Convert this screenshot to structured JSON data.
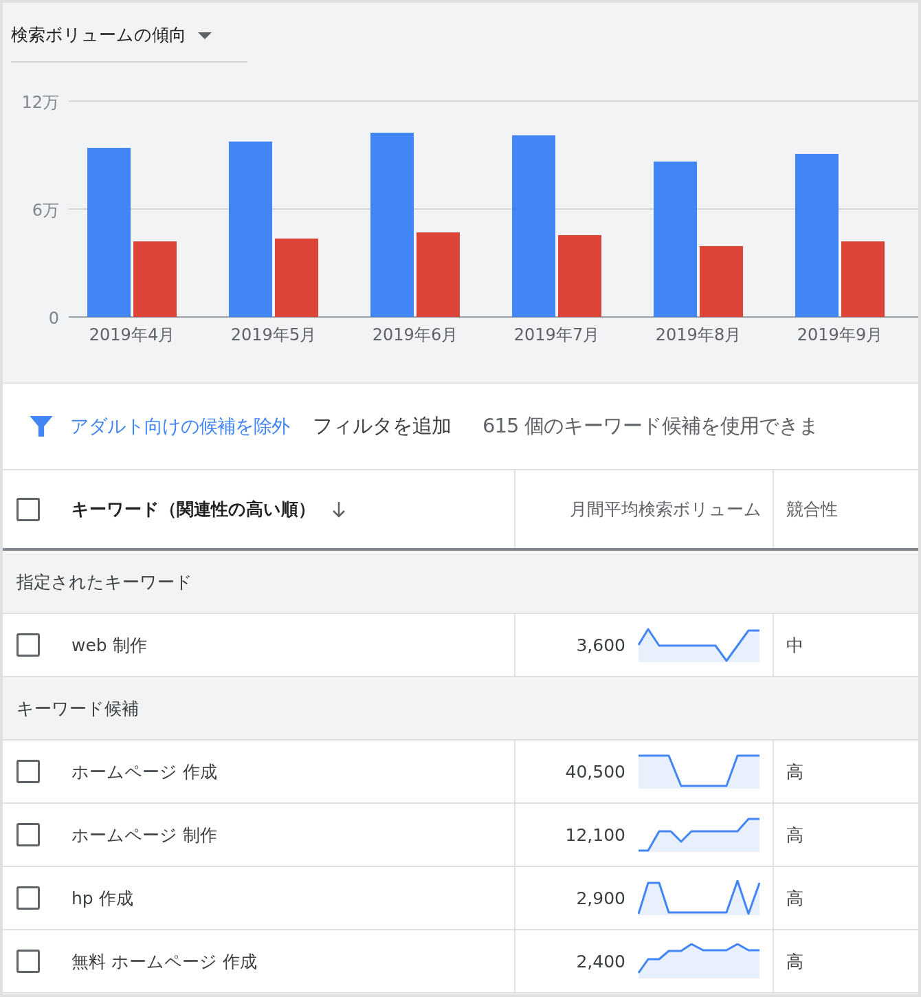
{
  "trend_panel": {
    "title": "検索ボリュームの傾向",
    "chart_data": {
      "type": "bar",
      "categories": [
        "2019年4月",
        "2019年5月",
        "2019年6月",
        "2019年7月",
        "2019年8月",
        "2019年9月"
      ],
      "series": [
        {
          "color": "#4285f4",
          "values": [
            9.4,
            9.75,
            10.24,
            10.1,
            8.64,
            9.06
          ]
        },
        {
          "color": "#db4437",
          "values": [
            4.2,
            4.36,
            4.7,
            4.55,
            3.94,
            4.2
          ]
        }
      ],
      "ylim": [
        0,
        12
      ],
      "yticks": [
        {
          "value": 0,
          "label": "0"
        },
        {
          "value": 6,
          "label": "6万"
        },
        {
          "value": 12,
          "label": "12万"
        }
      ]
    }
  },
  "filter_bar": {
    "exclude_link": "アダルト向けの候補を除外",
    "add_filter": "フィルタを追加",
    "count_text": "615 個のキーワード候補を使用できま"
  },
  "table": {
    "header_checked": false,
    "columns": [
      "キーワード（関連性の高い順）",
      "月間平均検索ボリューム",
      "競合性"
    ],
    "rows": [
      {
        "kind": "section",
        "label": "指定されたキーワード"
      },
      {
        "kind": "keyword",
        "checked": false,
        "keyword": "web 制作",
        "volume": "3,600",
        "competition": "中"
      },
      {
        "kind": "section",
        "label": "キーワード候補"
      },
      {
        "kind": "keyword",
        "checked": false,
        "keyword": "ホームページ 作成",
        "volume": "40,500",
        "competition": "高"
      },
      {
        "kind": "keyword",
        "checked": false,
        "keyword": "ホームページ 制作",
        "volume": "12,100",
        "competition": "高"
      },
      {
        "kind": "keyword",
        "checked": false,
        "keyword": "hp 作成",
        "volume": "2,900",
        "competition": "高"
      },
      {
        "kind": "keyword",
        "checked": false,
        "keyword": "無料 ホームページ 作成",
        "volume": "2,400",
        "competition": "高"
      }
    ]
  }
}
